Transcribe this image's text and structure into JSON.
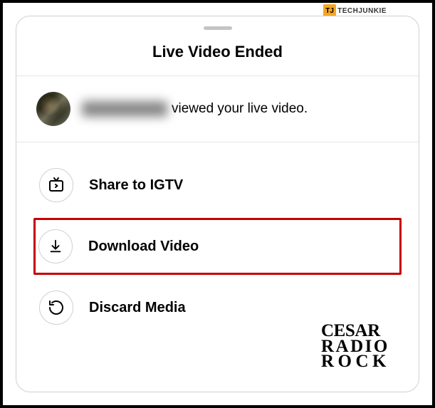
{
  "badge": {
    "logo": "TJ",
    "text": "TECHJUNKIE"
  },
  "sheet": {
    "title": "Live Video Ended",
    "viewer_suffix": "viewed your live video."
  },
  "options": {
    "share": "Share to IGTV",
    "download": "Download Video",
    "discard": "Discard Media"
  },
  "watermark": {
    "line1": "Cesar",
    "line2": "Radio",
    "line3": "Rock"
  }
}
